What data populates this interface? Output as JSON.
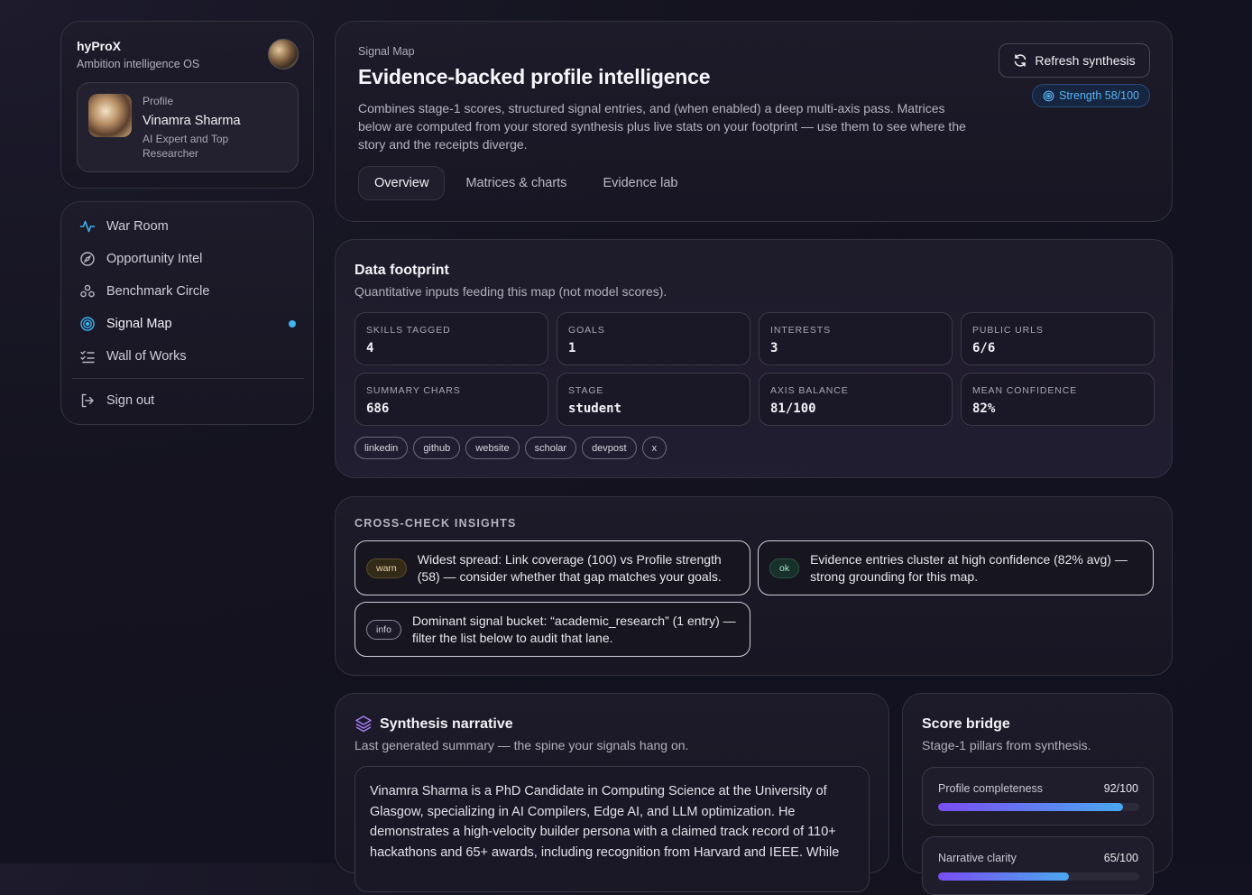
{
  "brand": {
    "name": "hyProX",
    "tagline": "Ambition intelligence OS"
  },
  "profile": {
    "kicker": "Profile",
    "name": "Vinamra Sharma",
    "role": "AI Expert and Top Researcher"
  },
  "nav": {
    "items": [
      {
        "label": "War Room",
        "icon": "activity-icon"
      },
      {
        "label": "Opportunity Intel",
        "icon": "compass-icon"
      },
      {
        "label": "Benchmark Circle",
        "icon": "users-icon"
      },
      {
        "label": "Signal Map",
        "icon": "radar-icon",
        "active": true
      },
      {
        "label": "Wall of Works",
        "icon": "list-checks-icon"
      }
    ],
    "sign_out": "Sign out"
  },
  "header": {
    "kicker": "Signal Map",
    "title": "Evidence-backed profile intelligence",
    "description": "Combines stage-1 scores, structured signal entries, and (when enabled) a deep multi-axis pass. Matrices below are computed from your stored synthesis plus live stats on your footprint — use them to see where the story and the receipts diverge.",
    "refresh_label": "Refresh synthesis",
    "strength_label": "Strength 58/100",
    "tabs": [
      "Overview",
      "Matrices & charts",
      "Evidence lab"
    ]
  },
  "footprint": {
    "title": "Data footprint",
    "subtitle": "Quantitative inputs feeding this map (not model scores).",
    "stats": [
      {
        "label": "Skills tagged",
        "value": "4"
      },
      {
        "label": "Goals",
        "value": "1"
      },
      {
        "label": "Interests",
        "value": "3"
      },
      {
        "label": "Public URLs",
        "value": "6/6"
      },
      {
        "label": "Summary chars",
        "value": "686"
      },
      {
        "label": "Stage",
        "value": "student"
      },
      {
        "label": "Axis balance",
        "value": "81/100"
      },
      {
        "label": "Mean confidence",
        "value": "82%"
      }
    ],
    "chips": [
      "linkedin",
      "github",
      "website",
      "scholar",
      "devpost",
      "x"
    ]
  },
  "insights": {
    "title": "CROSS-CHECK INSIGHTS",
    "items": [
      {
        "tag": "warn",
        "text": "Widest spread: Link coverage (100) vs Profile strength (58) — consider whether that gap matches your goals."
      },
      {
        "tag": "ok",
        "text": "Evidence entries cluster at high confidence (82% avg) — strong grounding for this map."
      },
      {
        "tag": "info",
        "text": "Dominant signal bucket: “academic_research” (1 entry) — filter the list below to audit that lane."
      }
    ]
  },
  "synthesis": {
    "title": "Synthesis narrative",
    "subtitle": "Last generated summary — the spine your signals hang on.",
    "body": "Vinamra Sharma is a PhD Candidate in Computing Science at the University of Glasgow, specializing in AI Compilers, Edge AI, and LLM optimization. He demonstrates a high-velocity builder persona with a claimed track record of 110+ hackathons and 65+ awards, including recognition from Harvard and IEEE. While"
  },
  "score_bridge": {
    "title": "Score bridge",
    "subtitle": "Stage-1 pillars from synthesis.",
    "pillars": [
      {
        "label": "Profile completeness",
        "value_text": "92/100",
        "fraction": 0.92
      },
      {
        "label": "Narrative clarity",
        "value_text": "65/100",
        "fraction": 0.65
      }
    ]
  },
  "colors": {
    "accent_blue": "#3fb6f2",
    "accent_purple": "#7a4df2",
    "warn": "#e9d4a8",
    "ok": "#a9e4cc"
  }
}
